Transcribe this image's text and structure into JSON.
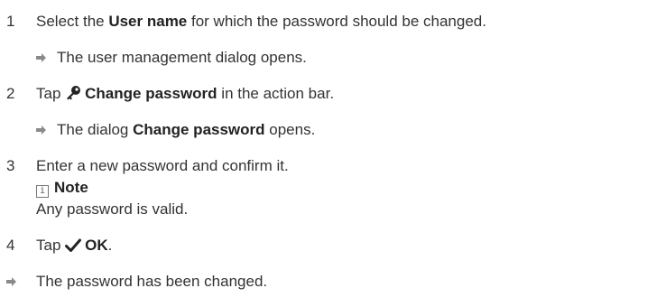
{
  "steps": [
    {
      "number": "1",
      "pre": "Select the ",
      "bold": "User name",
      "post": " for which the password should be changed.",
      "result": "The user management dialog opens."
    },
    {
      "number": "2",
      "pre": "Tap ",
      "icon": "key-icon",
      "bold": "Change password",
      "post": " in the action bar.",
      "result_pre": "The dialog ",
      "result_bold": "Change password",
      "result_post": " opens."
    },
    {
      "number": "3",
      "text": "Enter a new password and confirm it.",
      "note_icon_text": "i",
      "note_label": "Note",
      "note_text": "Any password is valid."
    },
    {
      "number": "4",
      "pre": "Tap ",
      "icon": "checkmark-icon",
      "bold": "OK",
      "post": "."
    }
  ],
  "final_result": "The password has been changed.",
  "colors": {
    "text": "#333333",
    "arrow": "#8a8a8a"
  }
}
